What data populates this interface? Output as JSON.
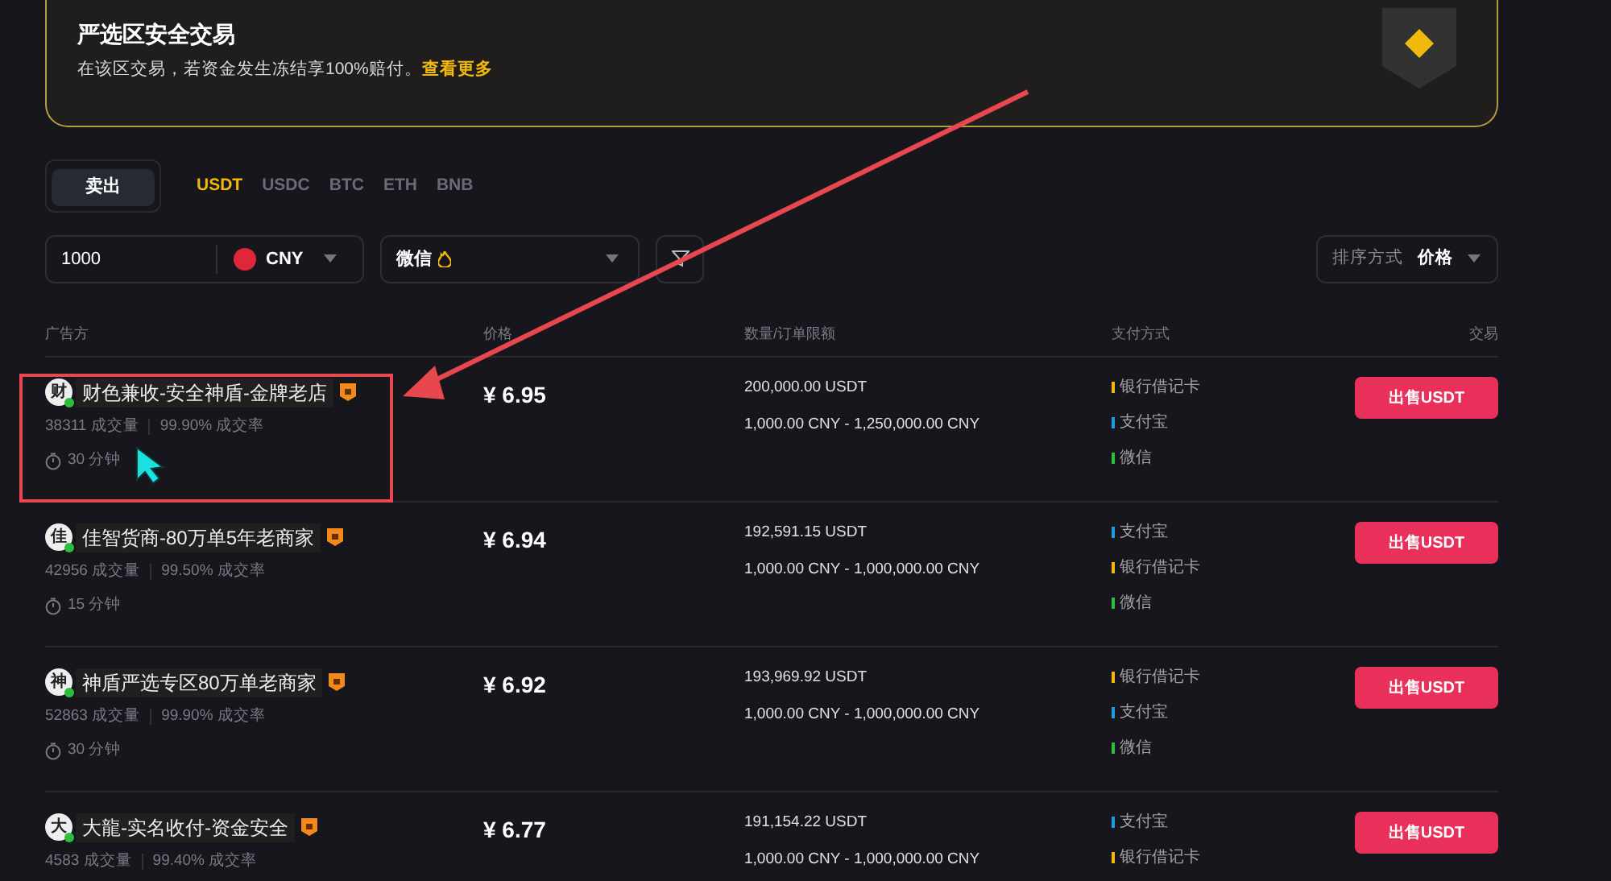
{
  "banner": {
    "title": "严选区安全交易",
    "text": "在该区交易，若资金发生冻结享100%赔付。",
    "link": "查看更多"
  },
  "side_tabs": [
    {
      "label": "卖出",
      "selected": true
    }
  ],
  "assets": [
    {
      "label": "USDT",
      "selected": true
    },
    {
      "label": "USDC",
      "selected": false
    },
    {
      "label": "BTC",
      "selected": false
    },
    {
      "label": "ETH",
      "selected": false
    },
    {
      "label": "BNB",
      "selected": false
    }
  ],
  "amount": {
    "value": "1000",
    "currency": "CNY"
  },
  "payment_filter": {
    "value": "微信"
  },
  "sort": {
    "label": "排序方式",
    "value": "价格"
  },
  "table": {
    "columns": [
      "广告方",
      "价格",
      "数量/订单限额",
      "支付方式",
      "交易"
    ],
    "rows": [
      {
        "avatar": "财",
        "name": "财色兼收-安全神盾-金牌老店",
        "orders": "38311 成交量",
        "rate": "99.90% 成交率",
        "time": "30 分钟",
        "price": "¥ 6.95",
        "quantity": "200,000.00 USDT",
        "limit": "1,000.00 CNY - 1,250,000.00 CNY",
        "payments": [
          {
            "label": "银行借记卡",
            "color": "#f0b90b"
          },
          {
            "label": "支付宝",
            "color": "#1e9ee0"
          },
          {
            "label": "微信",
            "color": "#2ebd3f"
          }
        ],
        "button": "出售USDT",
        "highlighted": true
      },
      {
        "avatar": "佳",
        "name": "佳智货商-80万单5年老商家",
        "orders": "42956 成交量",
        "rate": "99.50% 成交率",
        "time": "15 分钟",
        "price": "¥ 6.94",
        "quantity": "192,591.15 USDT",
        "limit": "1,000.00 CNY - 1,000,000.00 CNY",
        "payments": [
          {
            "label": "支付宝",
            "color": "#1e9ee0"
          },
          {
            "label": "银行借记卡",
            "color": "#f0b90b"
          },
          {
            "label": "微信",
            "color": "#2ebd3f"
          }
        ],
        "button": "出售USDT",
        "highlighted": false
      },
      {
        "avatar": "神",
        "name": "神盾严选专区80万单老商家",
        "orders": "52863 成交量",
        "rate": "99.90% 成交率",
        "time": "30 分钟",
        "price": "¥ 6.92",
        "quantity": "193,969.92 USDT",
        "limit": "1,000.00 CNY - 1,000,000.00 CNY",
        "payments": [
          {
            "label": "银行借记卡",
            "color": "#f0b90b"
          },
          {
            "label": "支付宝",
            "color": "#1e9ee0"
          },
          {
            "label": "微信",
            "color": "#2ebd3f"
          }
        ],
        "button": "出售USDT",
        "highlighted": false
      },
      {
        "avatar": "大",
        "name": "大龍-实名收付-资金安全",
        "orders": "4583 成交量",
        "rate": "99.40% 成交率",
        "price": "¥ 6.77",
        "quantity": "191,154.22 USDT",
        "limit": "1,000.00 CNY - 1,000,000.00 CNY",
        "payments": [
          {
            "label": "支付宝",
            "color": "#1e9ee0"
          },
          {
            "label": "银行借记卡",
            "color": "#f0b90b"
          }
        ],
        "button": "出售USDT",
        "highlighted": false
      }
    ]
  }
}
